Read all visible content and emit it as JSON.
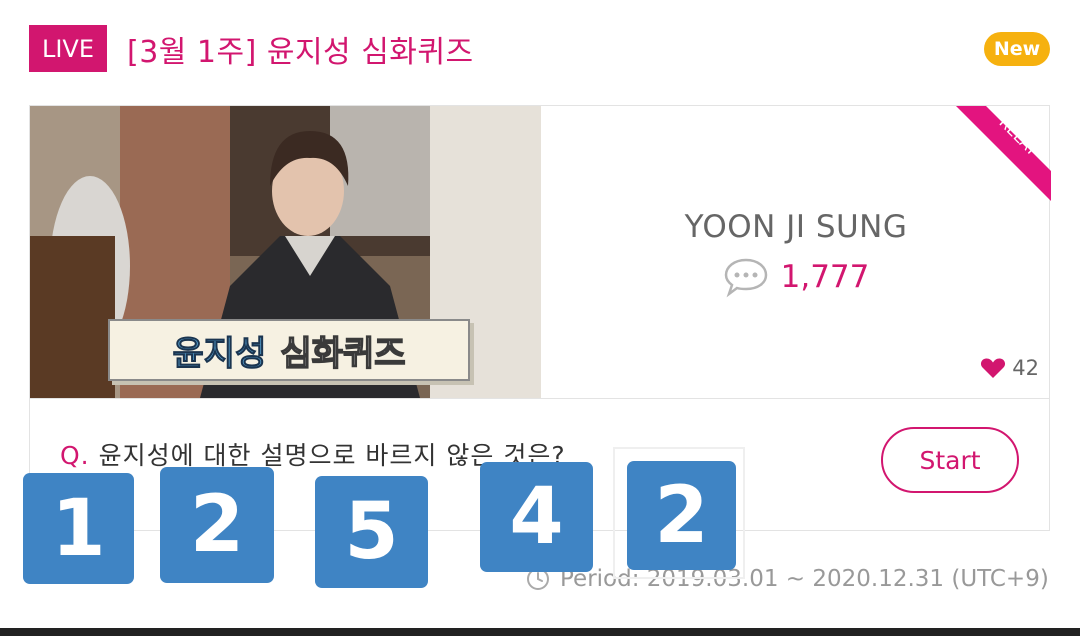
{
  "header": {
    "live_label": "LIVE",
    "title": "[3월 1주] 윤지성 심화퀴즈",
    "new_label": "New"
  },
  "card": {
    "thumbnail_caption_highlight": "윤지성",
    "thumbnail_caption_rest": "심화퀴즈",
    "ribbon_label": "RELAY",
    "artist_name": "YOON JI SUNG",
    "comment_count": "1,777",
    "like_count": "42",
    "question_prefix": "Q.",
    "question_text": "윤지성에 대한 설명으로 바르지 않은 것은?",
    "start_label": "Start"
  },
  "period": "Period: 2019.03.01 ~ 2020.12.31 (UTC+9)",
  "number_tiles": [
    "1",
    "2",
    "5",
    "4",
    "2"
  ],
  "colors": {
    "brand": "#d2166f",
    "new_badge": "#f6b10f",
    "tile": "#3f84c4"
  },
  "icons": [
    "speech-bubble-icon",
    "heart-icon",
    "clock-icon"
  ]
}
